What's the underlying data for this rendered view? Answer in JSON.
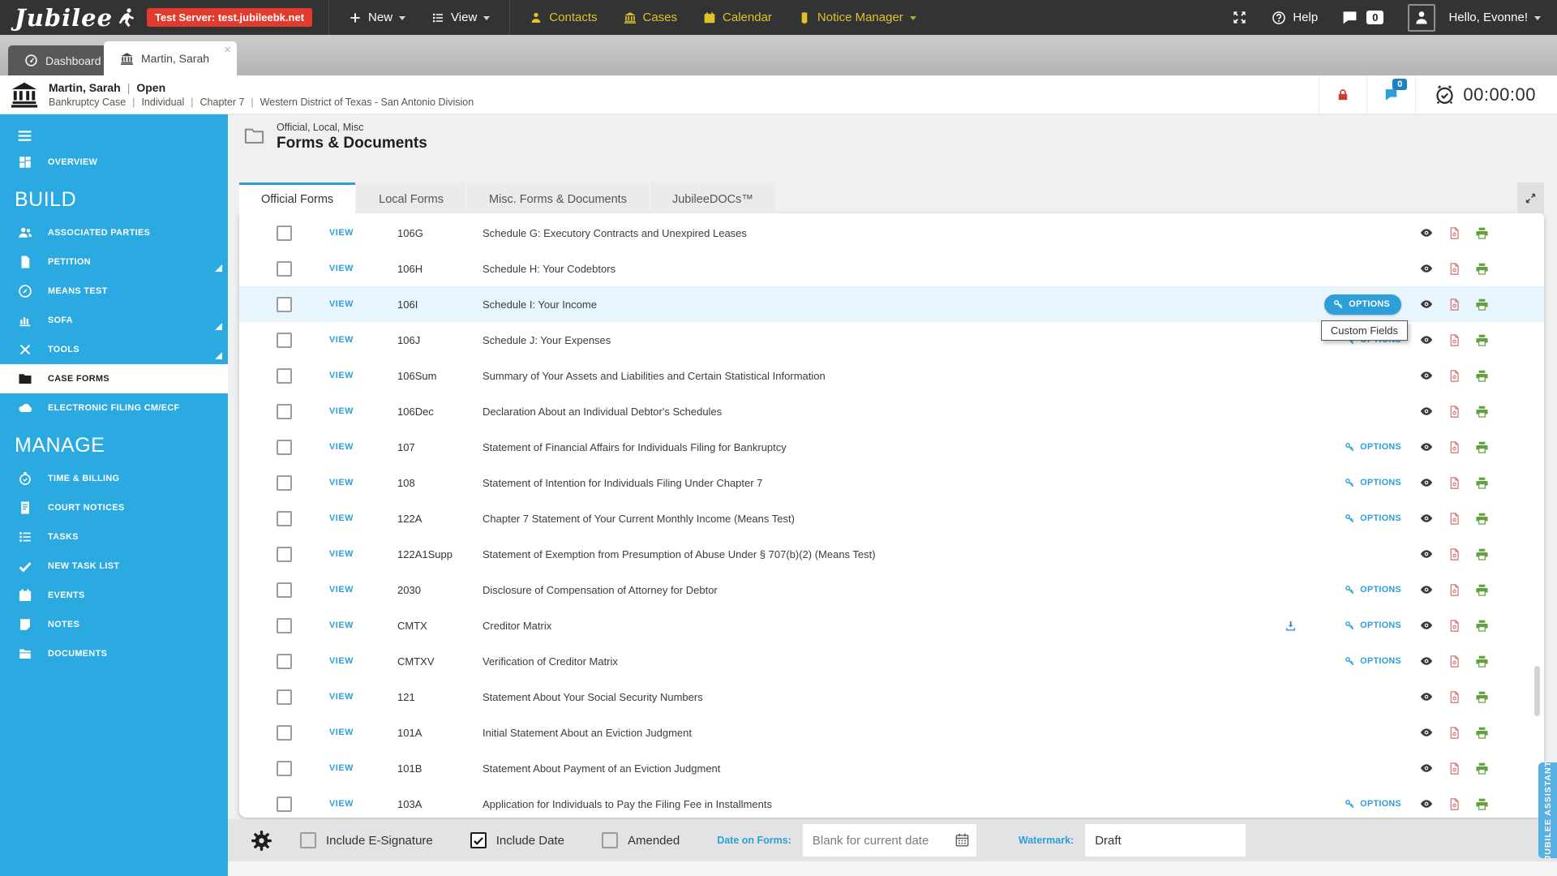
{
  "top_nav": {
    "logo": "Jubilee",
    "test_server_badge": "Test Server: test.jubileebk.net",
    "menu": [
      {
        "id": "new",
        "label": "New",
        "icon": "plus",
        "chevron": true,
        "yellow": false
      },
      {
        "id": "view",
        "label": "View",
        "icon": "viewlist",
        "chevron": true,
        "yellow": false
      },
      {
        "id": "contacts",
        "label": "Contacts",
        "icon": "person",
        "chevron": false,
        "yellow": true
      },
      {
        "id": "cases",
        "label": "Cases",
        "icon": "bank",
        "chevron": false,
        "yellow": true
      },
      {
        "id": "calendar",
        "label": "Calendar",
        "icon": "calendar",
        "chevron": false,
        "yellow": true
      },
      {
        "id": "notice-manager",
        "label": "Notice Manager",
        "icon": "notice",
        "chevron": true,
        "yellow": true
      }
    ],
    "help_label": "Help",
    "messages_count": "0",
    "greeting": "Hello, Evonne!"
  },
  "window_tabs": [
    {
      "id": "dashboard",
      "label": "Dashboard",
      "icon": "gauge",
      "active": false
    },
    {
      "id": "case-martin-sarah",
      "label": "Martin, Sarah",
      "icon": "bank",
      "active": true,
      "closable": true
    }
  ],
  "case_bar": {
    "name": "Martin, Sarah",
    "status": "Open",
    "details": [
      "Bankruptcy Case",
      "Individual",
      "Chapter 7",
      "Western District of Texas - San Antonio Division"
    ],
    "messages_count": "0",
    "timer": "00:00:00"
  },
  "sidebar": {
    "sections": [
      {
        "header": "",
        "items": [
          {
            "id": "overview",
            "label": "OVERVIEW",
            "icon": "grid",
            "active": false,
            "expandable": false
          }
        ]
      },
      {
        "header": "BUILD",
        "items": [
          {
            "id": "associated-parties",
            "label": "ASSOCIATED PARTIES",
            "icon": "people",
            "active": false,
            "expandable": false
          },
          {
            "id": "petition",
            "label": "PETITION",
            "icon": "doc",
            "active": false,
            "expandable": true
          },
          {
            "id": "means-test",
            "label": "MEANS TEST",
            "icon": "compass",
            "active": false,
            "expandable": false
          },
          {
            "id": "sofa",
            "label": "SOFA",
            "icon": "chart",
            "active": false,
            "expandable": true
          },
          {
            "id": "tools",
            "label": "TOOLS",
            "icon": "tools",
            "active": false,
            "expandable": true
          },
          {
            "id": "case-forms",
            "label": "CASE FORMS",
            "icon": "folder",
            "active": true,
            "expandable": false
          },
          {
            "id": "electronic-filing",
            "label": "ELECTRONIC FILING CM/ECF",
            "icon": "cloud",
            "active": false,
            "expandable": false
          }
        ]
      },
      {
        "header": "MANAGE",
        "items": [
          {
            "id": "time-billing",
            "label": "TIME & BILLING",
            "icon": "stopwatch",
            "active": false,
            "expandable": false
          },
          {
            "id": "court-notices",
            "label": "COURT NOTICES",
            "icon": "filedoc",
            "active": false,
            "expandable": false
          },
          {
            "id": "tasks",
            "label": "TASKS",
            "icon": "viewlist",
            "active": false,
            "expandable": false
          },
          {
            "id": "new-task-list",
            "label": "NEW TASK LIST",
            "icon": "check",
            "active": false,
            "expandable": false
          },
          {
            "id": "events",
            "label": "EVENTS",
            "icon": "calendar",
            "active": false,
            "expandable": false
          },
          {
            "id": "notes",
            "label": "NOTES",
            "icon": "note",
            "active": false,
            "expandable": false
          },
          {
            "id": "documents",
            "label": "DOCUMENTS",
            "icon": "docs",
            "active": false,
            "expandable": false
          }
        ]
      }
    ]
  },
  "page": {
    "eyebrow": "Official, Local, Misc",
    "title": "Forms & Documents"
  },
  "form_tabs": [
    {
      "label": "Official Forms",
      "active": true
    },
    {
      "label": "Local Forms",
      "active": false
    },
    {
      "label": "Misc. Forms & Documents",
      "active": false
    },
    {
      "label": "JubileeDOCs™",
      "active": false
    }
  ],
  "table": {
    "view_label": "VIEW",
    "options_label": "OPTIONS",
    "tooltip": "Custom Fields",
    "rows": [
      {
        "number": "106G",
        "title": "Schedule G: Executory Contracts and Unexpired Leases",
        "options": "none",
        "download": false,
        "highlighted": false,
        "tooltip": false
      },
      {
        "number": "106H",
        "title": "Schedule H: Your Codebtors",
        "options": "none",
        "download": false,
        "highlighted": false,
        "tooltip": false
      },
      {
        "number": "106I",
        "title": "Schedule I: Your Income",
        "options": "pill",
        "download": false,
        "highlighted": true,
        "tooltip": true
      },
      {
        "number": "106J",
        "title": "Schedule J: Your Expenses",
        "options": "link",
        "download": false,
        "highlighted": false,
        "tooltip": false
      },
      {
        "number": "106Sum",
        "title": "Summary of Your Assets and Liabilities and Certain Statistical Information",
        "options": "none",
        "download": false,
        "highlighted": false,
        "tooltip": false
      },
      {
        "number": "106Dec",
        "title": "Declaration About an Individual Debtor's Schedules",
        "options": "none",
        "download": false,
        "highlighted": false,
        "tooltip": false
      },
      {
        "number": "107",
        "title": "Statement of Financial Affairs for Individuals Filing for Bankruptcy",
        "options": "link",
        "download": false,
        "highlighted": false,
        "tooltip": false
      },
      {
        "number": "108",
        "title": "Statement of Intention for Individuals Filing Under Chapter 7",
        "options": "link",
        "download": false,
        "highlighted": false,
        "tooltip": false
      },
      {
        "number": "122A",
        "title": "Chapter 7 Statement of Your Current Monthly Income (Means Test)",
        "options": "link",
        "download": false,
        "highlighted": false,
        "tooltip": false
      },
      {
        "number": "122A1Supp",
        "title": "Statement of Exemption from Presumption of Abuse Under § 707(b)(2) (Means Test)",
        "options": "none",
        "download": false,
        "highlighted": false,
        "tooltip": false
      },
      {
        "number": "2030",
        "title": "Disclosure of Compensation of Attorney for Debtor",
        "options": "link",
        "download": false,
        "highlighted": false,
        "tooltip": false
      },
      {
        "number": "CMTX",
        "title": "Creditor Matrix",
        "options": "link",
        "download": true,
        "highlighted": false,
        "tooltip": false
      },
      {
        "number": "CMTXV",
        "title": "Verification of Creditor Matrix",
        "options": "link",
        "download": false,
        "highlighted": false,
        "tooltip": false
      },
      {
        "number": "121",
        "title": "Statement About Your Social Security Numbers",
        "options": "none",
        "download": false,
        "highlighted": false,
        "tooltip": false
      },
      {
        "number": "101A",
        "title": "Initial Statement About an Eviction Judgment",
        "options": "none",
        "download": false,
        "highlighted": false,
        "tooltip": false
      },
      {
        "number": "101B",
        "title": "Statement About Payment of an Eviction Judgment",
        "options": "none",
        "download": false,
        "highlighted": false,
        "tooltip": false
      },
      {
        "number": "103A",
        "title": "Application for Individuals to Pay the Filing Fee in Installments",
        "options": "link",
        "download": false,
        "highlighted": false,
        "tooltip": false
      }
    ]
  },
  "footer": {
    "checkboxes": [
      {
        "id": "include-esignature",
        "label": "Include E-Signature",
        "checked": false
      },
      {
        "id": "include-date",
        "label": "Include Date",
        "checked": true
      },
      {
        "id": "amended",
        "label": "Amended",
        "checked": false
      }
    ],
    "date_label": "Date on Forms:",
    "date_placeholder": "Blank for current date",
    "watermark_label": "Watermark:",
    "watermark_value": "Draft"
  },
  "assistant_tab": "JUBILEE ASSISTANT",
  "colors": {
    "accent": "#2e9fd9",
    "sidebar_blue": "#2baae1",
    "badge_red": "#e23b2e",
    "print_green": "#61a23e",
    "pdf_red": "#d07272"
  }
}
